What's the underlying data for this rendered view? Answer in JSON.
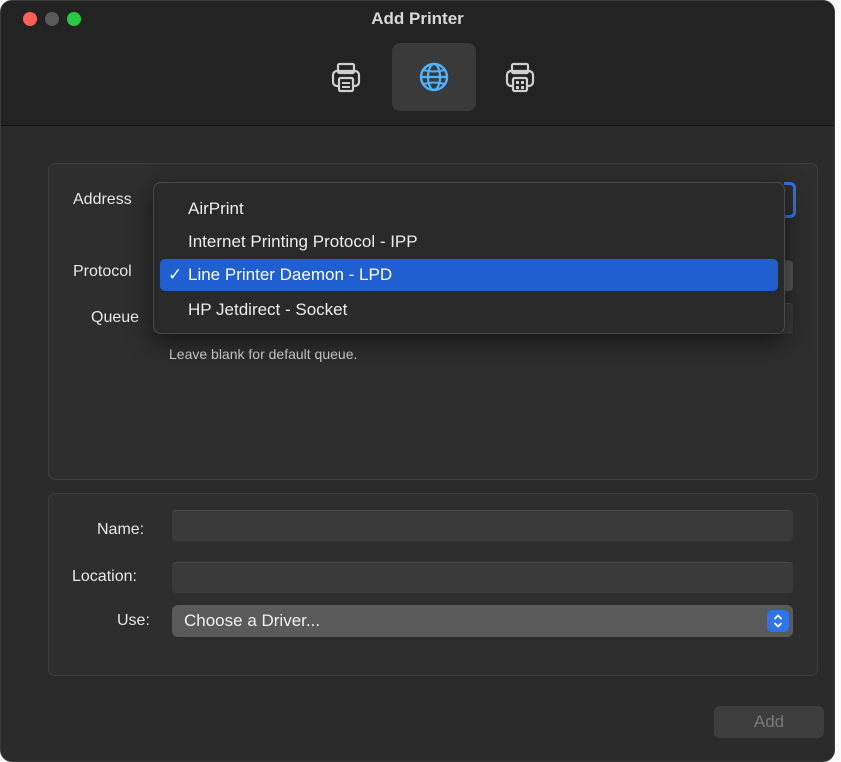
{
  "window": {
    "title": "Add Printer",
    "toolbar": [
      {
        "name": "Default",
        "icon": "printer-icon"
      },
      {
        "name": "IP",
        "icon": "globe-icon",
        "selected": true
      },
      {
        "name": "Windows",
        "icon": "printer-share-icon"
      }
    ]
  },
  "top_panel": {
    "address_label": "Address",
    "protocol_label": "Protocol",
    "queue_label": "Queue",
    "queue_hint": "Leave blank for default queue."
  },
  "protocol_menu": {
    "options": [
      "AirPrint",
      "Internet Printing Protocol - IPP",
      "Line Printer Daemon - LPD",
      "HP Jetdirect - Socket"
    ],
    "selected_index": 2,
    "check_glyph": "✓"
  },
  "bottom_panel": {
    "name_label": "Name:",
    "location_label": "Location:",
    "use_label": "Use:",
    "use_value": "Choose a Driver..."
  },
  "actions": {
    "add_label": "Add"
  },
  "colors": {
    "accent": "#1f5fd1",
    "background": "#2b2b2b",
    "close": "#ff5f57",
    "zoom": "#28c840"
  }
}
